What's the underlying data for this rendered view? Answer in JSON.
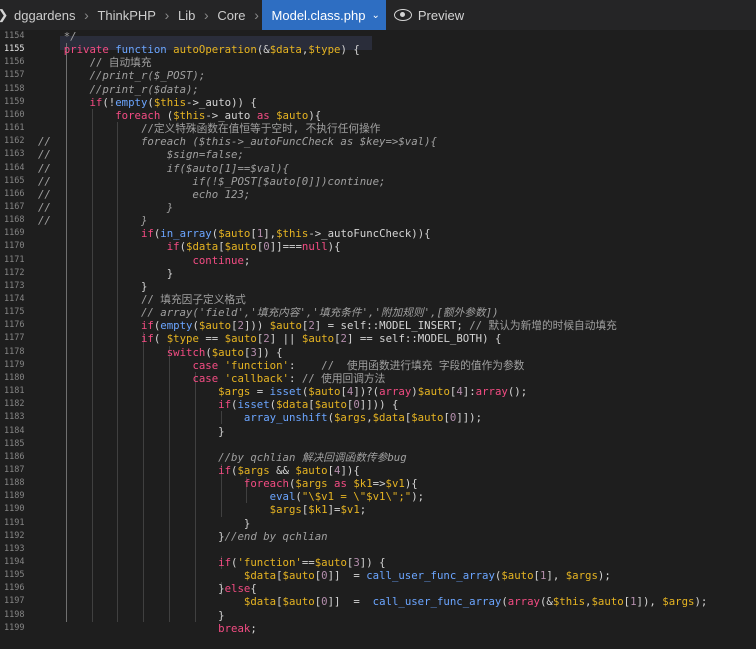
{
  "breadcrumb": {
    "items": [
      "dggardens",
      "ThinkPHP",
      "Lib",
      "Core"
    ],
    "active_file": "Model.class.php",
    "preview_label": "Preview"
  },
  "editor": {
    "current_line": 1155,
    "lines": [
      {
        "n": 1154,
        "indent": 0,
        "html": "    <span class=\"c\">*/</span>"
      },
      {
        "n": 1155,
        "indent": 0,
        "html": "    <span class=\"k\">private</span> <span class=\"f\">function</span> <span class=\"s\">autoOperation</span>(&amp;<span class=\"s\">$data</span>,<span class=\"s\">$type</span>) {"
      },
      {
        "n": 1156,
        "indent": 0,
        "html": "        <span class=\"cn\">// 自动填充</span>"
      },
      {
        "n": 1157,
        "indent": 0,
        "html": "        <span class=\"c\">//print_r($_POST);</span>"
      },
      {
        "n": 1158,
        "indent": 0,
        "html": "        <span class=\"c\">//print_r($data);</span>"
      },
      {
        "n": 1159,
        "indent": 0,
        "html": "        <span class=\"k\">if</span>(!<span class=\"f\">empty</span>(<span class=\"s\">$this</span>-&gt;_auto)) {"
      },
      {
        "n": 1160,
        "indent": 0,
        "html": "            <span class=\"k\">foreach</span> (<span class=\"s\">$this</span>-&gt;_auto <span class=\"k\">as</span> <span class=\"s\">$auto</span>){"
      },
      {
        "n": 1161,
        "indent": 0,
        "html": "                <span class=\"cn\">//定义特殊函数在值恒等于空时, 不执行任何操作</span>"
      },
      {
        "n": 1162,
        "indent": 0,
        "html": "<span class=\"c\">//              foreach ($this-&gt;_autoFuncCheck as $key=&gt;$val){</span>"
      },
      {
        "n": 1163,
        "indent": 0,
        "html": "<span class=\"c\">//                  $sign=false;</span>"
      },
      {
        "n": 1164,
        "indent": 0,
        "html": "<span class=\"c\">//                  if($auto[1]==$val){</span>"
      },
      {
        "n": 1165,
        "indent": 0,
        "html": "<span class=\"c\">//                      if(!$_POST[$auto[0]])continue;</span>"
      },
      {
        "n": 1166,
        "indent": 0,
        "html": "<span class=\"c\">//                      echo 123;</span>"
      },
      {
        "n": 1167,
        "indent": 0,
        "html": "<span class=\"c\">//                  }</span>"
      },
      {
        "n": 1168,
        "indent": 0,
        "html": "<span class=\"c\">//              }</span>"
      },
      {
        "n": 1169,
        "indent": 0,
        "html": "                <span class=\"k\">if</span>(<span class=\"f\">in_array</span>(<span class=\"s\">$auto</span>[<span class=\"n\">1</span>],<span class=\"s\">$this</span>-&gt;_autoFuncCheck)){"
      },
      {
        "n": 1170,
        "indent": 0,
        "html": "                    <span class=\"k\">if</span>(<span class=\"s\">$data</span>[<span class=\"s\">$auto</span>[<span class=\"n\">0</span>]]===<span class=\"k\">null</span>){"
      },
      {
        "n": 1171,
        "indent": 0,
        "html": "                        <span class=\"k\">continue</span>;"
      },
      {
        "n": 1172,
        "indent": 0,
        "html": "                    }"
      },
      {
        "n": 1173,
        "indent": 0,
        "html": "                }"
      },
      {
        "n": 1174,
        "indent": 0,
        "html": "                <span class=\"cn\">// 填充因子定义格式</span>"
      },
      {
        "n": 1175,
        "indent": 0,
        "html": "                <span class=\"c\">// array('field','填充内容','填充条件','附加规则',[额外参数])</span>"
      },
      {
        "n": 1176,
        "indent": 0,
        "html": "                <span class=\"k\">if</span>(<span class=\"f\">empty</span>(<span class=\"s\">$auto</span>[<span class=\"n\">2</span>])) <span class=\"s\">$auto</span>[<span class=\"n\">2</span>] = <span class=\"v\">self</span>::MODEL_INSERT; <span class=\"cn\">// 默认为新增的时候自动填充</span>"
      },
      {
        "n": 1177,
        "indent": 0,
        "html": "                <span class=\"k\">if</span>( <span class=\"s\">$type</span> == <span class=\"s\">$auto</span>[<span class=\"n\">2</span>] || <span class=\"s\">$auto</span>[<span class=\"n\">2</span>] == <span class=\"v\">self</span>::MODEL_BOTH) {"
      },
      {
        "n": 1178,
        "indent": 0,
        "html": "                    <span class=\"k\">switch</span>(<span class=\"s\">$auto</span>[<span class=\"n\">3</span>]) {"
      },
      {
        "n": 1179,
        "indent": 0,
        "html": "                        <span class=\"k\">case</span> <span class=\"s\">'function'</span>:    <span class=\"cn\">//  使用函数进行填充 字段的值作为参数</span>"
      },
      {
        "n": 1180,
        "indent": 0,
        "html": "                        <span class=\"k\">case</span> <span class=\"s\">'callback'</span>: <span class=\"cn\">// 使用回调方法</span>"
      },
      {
        "n": 1181,
        "indent": 0,
        "html": "                            <span class=\"s\">$args</span> = <span class=\"f\">isset</span>(<span class=\"s\">$auto</span>[<span class=\"n\">4</span>])?(<span class=\"k\">array</span>)<span class=\"s\">$auto</span>[<span class=\"n\">4</span>]:<span class=\"k\">array</span>();"
      },
      {
        "n": 1182,
        "indent": 0,
        "html": "                            <span class=\"k\">if</span>(<span class=\"f\">isset</span>(<span class=\"s\">$data</span>[<span class=\"s\">$auto</span>[<span class=\"n\">0</span>]])) {"
      },
      {
        "n": 1183,
        "indent": 0,
        "html": "                                <span class=\"f\">array_unshift</span>(<span class=\"s\">$args</span>,<span class=\"s\">$data</span>[<span class=\"s\">$auto</span>[<span class=\"n\">0</span>]]);"
      },
      {
        "n": 1184,
        "indent": 0,
        "html": "                            }"
      },
      {
        "n": 1185,
        "indent": 0,
        "html": ""
      },
      {
        "n": 1186,
        "indent": 0,
        "html": "                            <span class=\"c\">//by qchlian 解决回调函数传参bug</span>"
      },
      {
        "n": 1187,
        "indent": 0,
        "html": "                            <span class=\"k\">if</span>(<span class=\"s\">$args</span> &amp;&amp; <span class=\"s\">$auto</span>[<span class=\"n\">4</span>]){"
      },
      {
        "n": 1188,
        "indent": 0,
        "html": "                                <span class=\"k\">foreach</span>(<span class=\"s\">$args</span> <span class=\"k\">as</span> <span class=\"s\">$k1</span>=&gt;<span class=\"s\">$v1</span>){"
      },
      {
        "n": 1189,
        "indent": 0,
        "html": "                                    <span class=\"f\">eval</span>(<span class=\"s\">\"\\$v1 = \\\"$v1\\\";\"</span>);"
      },
      {
        "n": 1190,
        "indent": 0,
        "html": "                                    <span class=\"s\">$args</span>[<span class=\"s\">$k1</span>]=<span class=\"s\">$v1</span>;"
      },
      {
        "n": 1191,
        "indent": 0,
        "html": "                                }"
      },
      {
        "n": 1192,
        "indent": 0,
        "html": "                            }<span class=\"c\">//end by qchlian</span>"
      },
      {
        "n": 1193,
        "indent": 0,
        "html": ""
      },
      {
        "n": 1194,
        "indent": 0,
        "html": "                            <span class=\"k\">if</span>(<span class=\"s\">'function'</span>==<span class=\"s\">$auto</span>[<span class=\"n\">3</span>]) {"
      },
      {
        "n": 1195,
        "indent": 0,
        "html": "                                <span class=\"s\">$data</span>[<span class=\"s\">$auto</span>[<span class=\"n\">0</span>]]  = <span class=\"f\">call_user_func_array</span>(<span class=\"s\">$auto</span>[<span class=\"n\">1</span>], <span class=\"s\">$args</span>);"
      },
      {
        "n": 1196,
        "indent": 0,
        "html": "                            }<span class=\"k\">else</span>{"
      },
      {
        "n": 1197,
        "indent": 0,
        "html": "                                <span class=\"s\">$data</span>[<span class=\"s\">$auto</span>[<span class=\"n\">0</span>]]  =  <span class=\"f\">call_user_func_array</span>(<span class=\"k\">array</span>(&amp;<span class=\"s\">$this</span>,<span class=\"s\">$auto</span>[<span class=\"n\">1</span>]), <span class=\"s\">$args</span>);"
      },
      {
        "n": 1198,
        "indent": 0,
        "html": "                            }"
      },
      {
        "n": 1199,
        "indent": 0,
        "html": "                            <span class=\"k\">break</span>;"
      }
    ]
  }
}
